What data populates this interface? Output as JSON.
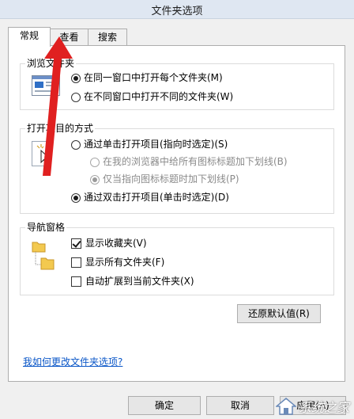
{
  "window": {
    "title": "文件夹选项"
  },
  "tabs": [
    {
      "label": "常规",
      "active": true
    },
    {
      "label": "查看",
      "active": false
    },
    {
      "label": "搜索",
      "active": false
    }
  ],
  "browse_group": {
    "title": "浏览文件夹",
    "options": [
      {
        "label": "在同一窗口中打开每个文件夹(M)",
        "checked": true
      },
      {
        "label": "在不同窗口中打开不同的文件夹(W)",
        "checked": false
      }
    ]
  },
  "click_group": {
    "title": "打开项目的方式",
    "options": [
      {
        "label": "通过单击打开项目(指向时选定)(S)",
        "checked": false
      },
      {
        "label": "在我的浏览器中给所有图标标题加下划线(B)",
        "checked": false,
        "disabled": true
      },
      {
        "label": "仅当指向图标标题时加下划线(P)",
        "checked": true,
        "disabled": true
      },
      {
        "label": "通过双击打开项目(单击时选定)(D)",
        "checked": true
      }
    ]
  },
  "nav_group": {
    "title": "导航窗格",
    "options": [
      {
        "label": "显示收藏夹(V)",
        "checked": true
      },
      {
        "label": "显示所有文件夹(F)",
        "checked": false
      },
      {
        "label": "自动扩展到当前文件夹(X)",
        "checked": false
      }
    ]
  },
  "restore_defaults_label": "还原默认值(R)",
  "help_link": "我如何更改文件夹选项?",
  "footer": {
    "ok_label": "确定",
    "cancel_label": "取消",
    "apply_label": "应用(A)"
  },
  "watermark": {
    "text": "系统之家"
  },
  "colors": {
    "accent": "#e02020",
    "link": "#0b57c8"
  }
}
